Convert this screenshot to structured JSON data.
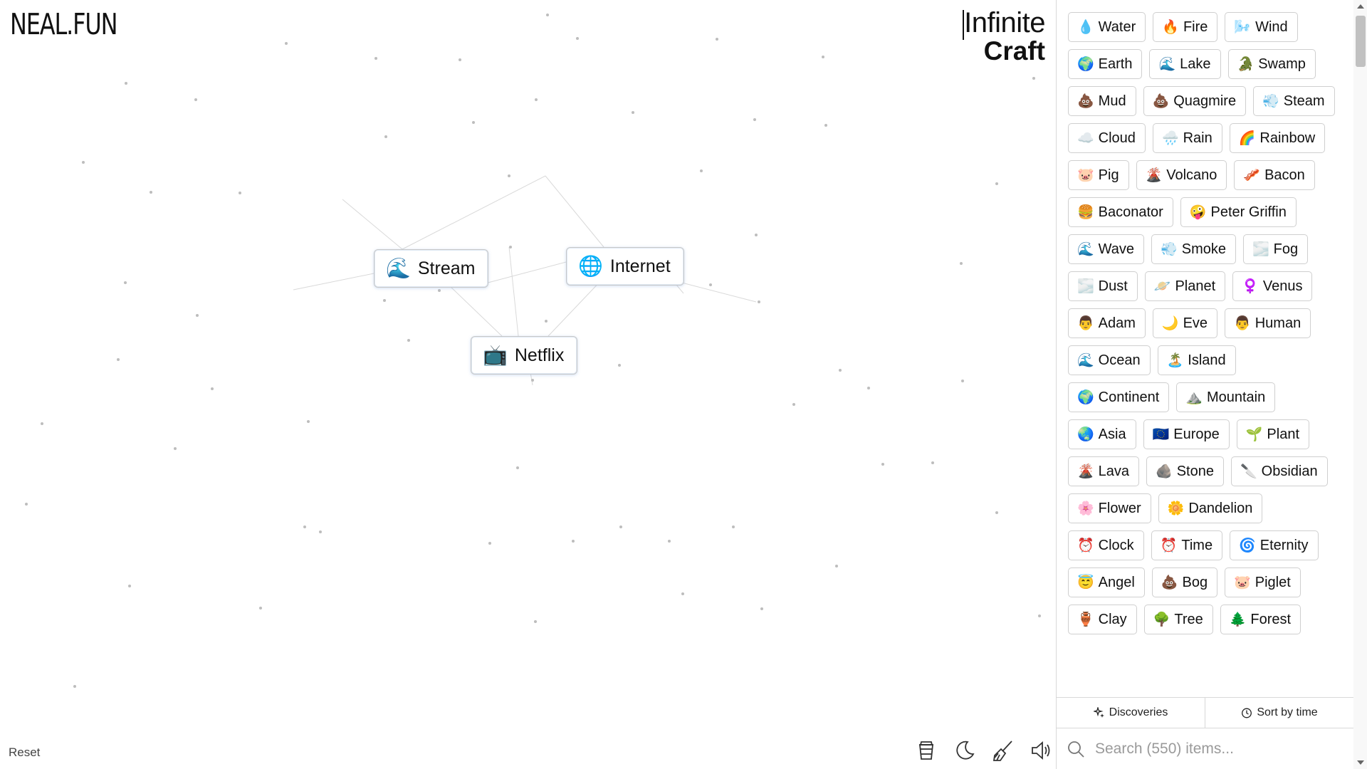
{
  "brand": {
    "logo": "NEAL.FUN",
    "title_line1": "Infinite",
    "title_line2": "Craft"
  },
  "canvas": {
    "instances": [
      {
        "emoji": "🌊",
        "label": "Stream"
      },
      {
        "emoji": "🌐",
        "label": "Internet"
      },
      {
        "emoji": "📺",
        "label": "Netflix"
      }
    ],
    "reset_label": "Reset",
    "tool_icons": [
      "coffee-cup-icon",
      "moon-icon",
      "broom-icon",
      "speaker-icon"
    ]
  },
  "sidebar": {
    "items": [
      {
        "emoji": "💧",
        "label": "Water"
      },
      {
        "emoji": "🔥",
        "label": "Fire"
      },
      {
        "emoji": "🌬️",
        "label": "Wind"
      },
      {
        "emoji": "🌍",
        "label": "Earth"
      },
      {
        "emoji": "🌊",
        "label": "Lake"
      },
      {
        "emoji": "🐊",
        "label": "Swamp"
      },
      {
        "emoji": "💩",
        "label": "Mud"
      },
      {
        "emoji": "💩",
        "label": "Quagmire"
      },
      {
        "emoji": "💨",
        "label": "Steam"
      },
      {
        "emoji": "☁️",
        "label": "Cloud"
      },
      {
        "emoji": "🌧️",
        "label": "Rain"
      },
      {
        "emoji": "🌈",
        "label": "Rainbow"
      },
      {
        "emoji": "🐷",
        "label": "Pig"
      },
      {
        "emoji": "🌋",
        "label": "Volcano"
      },
      {
        "emoji": "🥓",
        "label": "Bacon"
      },
      {
        "emoji": "🍔",
        "label": "Baconator"
      },
      {
        "emoji": "🤪",
        "label": "Peter Griffin"
      },
      {
        "emoji": "🌊",
        "label": "Wave"
      },
      {
        "emoji": "💨",
        "label": "Smoke"
      },
      {
        "emoji": "🌫️",
        "label": "Fog"
      },
      {
        "emoji": "🌫️",
        "label": "Dust"
      },
      {
        "emoji": "🪐",
        "label": "Planet"
      },
      {
        "emoji": "♀️",
        "label": "Venus"
      },
      {
        "emoji": "👨",
        "label": "Adam"
      },
      {
        "emoji": "🌙",
        "label": "Eve"
      },
      {
        "emoji": "👨",
        "label": "Human"
      },
      {
        "emoji": "🌊",
        "label": "Ocean"
      },
      {
        "emoji": "🏝️",
        "label": "Island"
      },
      {
        "emoji": "🌍",
        "label": "Continent"
      },
      {
        "emoji": "⛰️",
        "label": "Mountain"
      },
      {
        "emoji": "🌏",
        "label": "Asia"
      },
      {
        "emoji": "🇪🇺",
        "label": "Europe"
      },
      {
        "emoji": "🌱",
        "label": "Plant"
      },
      {
        "emoji": "🌋",
        "label": "Lava"
      },
      {
        "emoji": "🪨",
        "label": "Stone"
      },
      {
        "emoji": "🔪",
        "label": "Obsidian"
      },
      {
        "emoji": "🌸",
        "label": "Flower"
      },
      {
        "emoji": "🌼",
        "label": "Dandelion"
      },
      {
        "emoji": "⏰",
        "label": "Clock"
      },
      {
        "emoji": "⏰",
        "label": "Time"
      },
      {
        "emoji": "🌀",
        "label": "Eternity"
      },
      {
        "emoji": "😇",
        "label": "Angel"
      },
      {
        "emoji": "💩",
        "label": "Bog"
      },
      {
        "emoji": "🐷",
        "label": "Piglet"
      },
      {
        "emoji": "🏺",
        "label": "Clay"
      },
      {
        "emoji": "🌳",
        "label": "Tree"
      },
      {
        "emoji": "🌲",
        "label": "Forest"
      }
    ],
    "discoveries_label": "Discoveries",
    "sort_label": "Sort by time",
    "search_placeholder": "Search (550) items..."
  }
}
